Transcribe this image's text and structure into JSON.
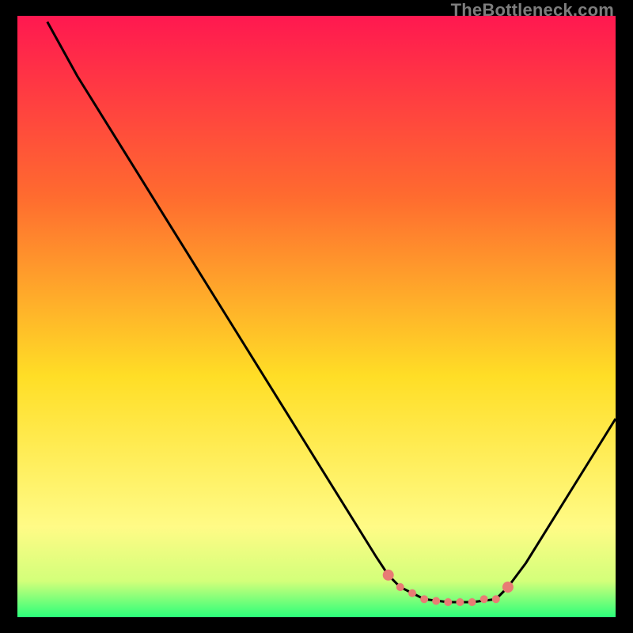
{
  "watermark": "TheBottleneck.com",
  "chart_data": {
    "type": "line",
    "title": "",
    "xlabel": "",
    "ylabel": "",
    "xlim": [
      0,
      100
    ],
    "ylim": [
      0,
      100
    ],
    "background_gradient": {
      "stops": [
        {
          "pct": 0,
          "color": "#ff1850"
        },
        {
          "pct": 30,
          "color": "#ff6b2f"
        },
        {
          "pct": 60,
          "color": "#ffde26"
        },
        {
          "pct": 85,
          "color": "#fffb86"
        },
        {
          "pct": 94,
          "color": "#d3ff7a"
        },
        {
          "pct": 100,
          "color": "#2bff7a"
        }
      ]
    },
    "series": [
      {
        "name": "bottleneck-curve",
        "color": "#000000",
        "x": [
          5,
          10,
          15,
          20,
          25,
          30,
          35,
          40,
          45,
          50,
          55,
          60,
          62,
          64,
          68,
          72,
          76,
          80,
          82,
          85,
          90,
          95,
          100
        ],
        "y": [
          99,
          90,
          82,
          74,
          66,
          58,
          50,
          42,
          34,
          26,
          18,
          10,
          7,
          5,
          3,
          2.5,
          2.5,
          3,
          5,
          9,
          17,
          25,
          33
        ]
      }
    ],
    "highlight_segment": {
      "name": "optimal-range",
      "color": "#e87c74",
      "x": [
        62,
        64,
        66,
        68,
        70,
        72,
        74,
        76,
        78,
        80,
        82
      ],
      "y": [
        7,
        5,
        4,
        3,
        2.7,
        2.5,
        2.5,
        2.5,
        3,
        3,
        5
      ],
      "dot_radius": 5
    }
  }
}
